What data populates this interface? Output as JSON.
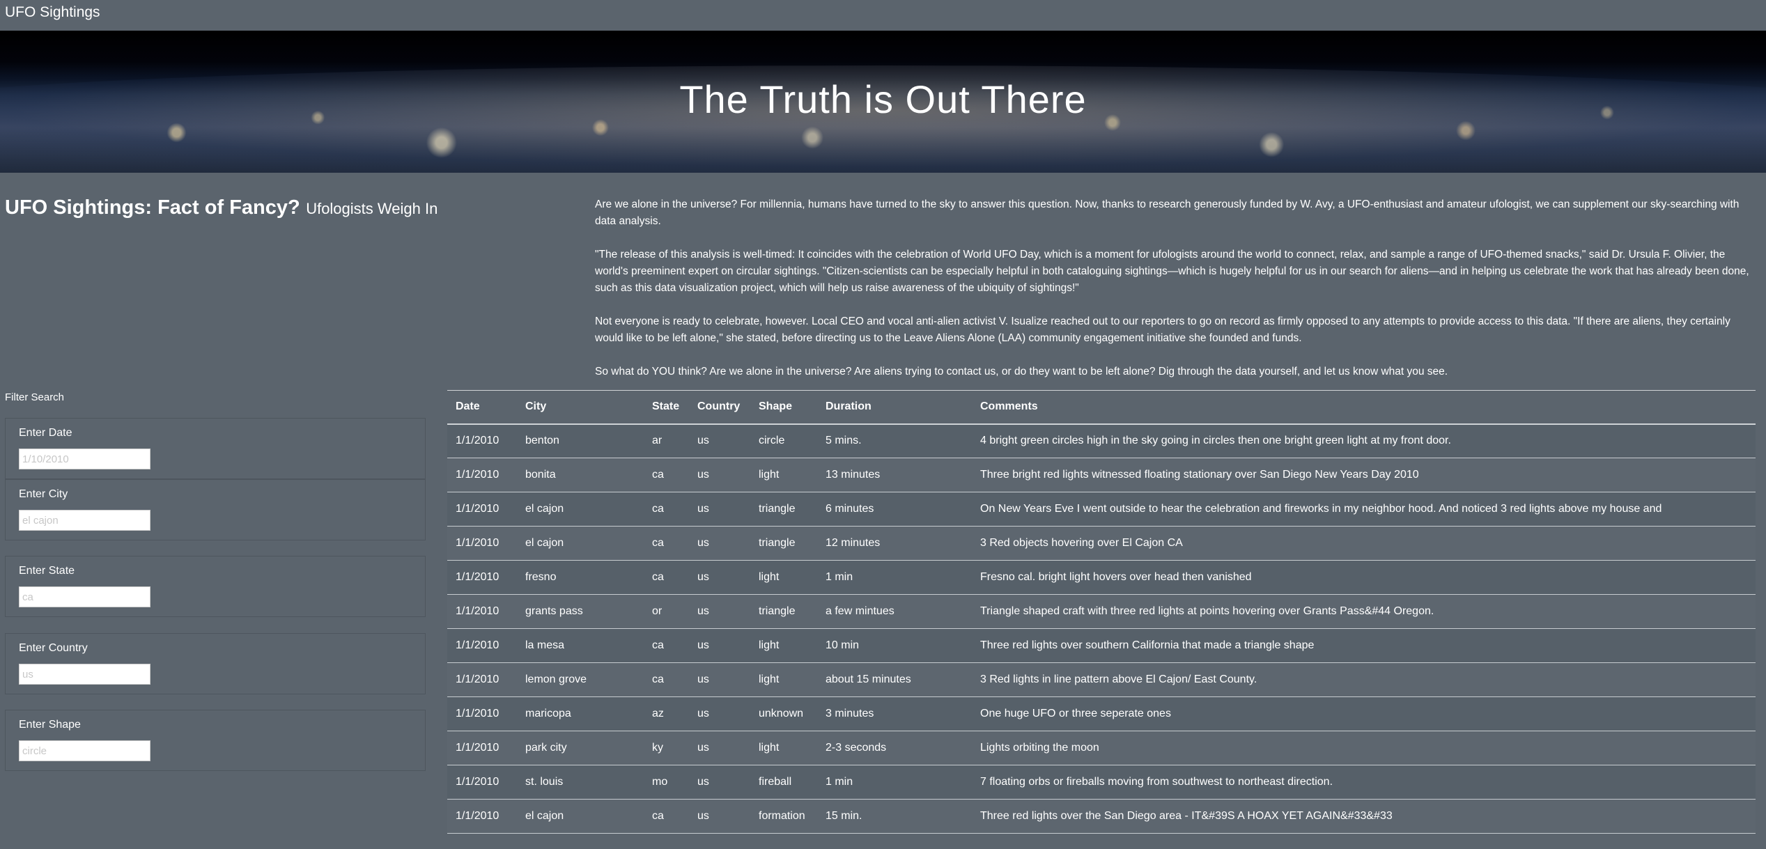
{
  "navbar": {
    "brand": "UFO Sightings"
  },
  "hero": {
    "title": "The Truth is Out There"
  },
  "headline": {
    "main": "UFO Sightings: Fact of Fancy?",
    "sub": "Ufologists Weigh In"
  },
  "article": {
    "paragraphs": [
      "Are we alone in the universe? For millennia, humans have turned to the sky to answer this question. Now, thanks to research generously funded by W. Avy, a UFO-enthusiast and amateur ufologist, we can supplement our sky-searching with data analysis.",
      "\"The release of this analysis is well-timed: It coincides with the celebration of World UFO Day, which is a moment for ufologists around the world to connect, relax, and sample a range of UFO-themed snacks,\" said Dr. Ursula F. Olivier, the world's preeminent expert on circular sightings. \"Citizen-scientists can be especially helpful in both cataloguing sightings—which is hugely helpful for us in our search for aliens—and in helping us celebrate the work that has already been done, such as this data visualization project, which will help us raise awareness of the ubiquity of sightings!\"",
      "Not everyone is ready to celebrate, however. Local CEO and vocal anti-alien activist V. Isualize reached out to our reporters to go on record as firmly opposed to any attempts to provide access to this data. \"If there are aliens, they certainly would like to be left alone,\" she stated, before directing us to the Leave Aliens Alone (LAA) community engagement initiative she founded and funds.",
      "So what do YOU think? Are we alone in the universe? Are aliens trying to contact us, or do they want to be left alone? Dig through the data yourself, and let us know what you see."
    ]
  },
  "filters": {
    "title": "Filter Search",
    "date": {
      "label": "Enter Date",
      "placeholder": "1/10/2010",
      "value": ""
    },
    "city": {
      "label": "Enter City",
      "placeholder": "el cajon",
      "value": ""
    },
    "state": {
      "label": "Enter State",
      "placeholder": "ca",
      "value": ""
    },
    "country": {
      "label": "Enter Country",
      "placeholder": "us",
      "value": ""
    },
    "shape": {
      "label": "Enter Shape",
      "placeholder": "circle",
      "value": ""
    }
  },
  "table": {
    "headers": [
      "Date",
      "City",
      "State",
      "Country",
      "Shape",
      "Duration",
      "Comments"
    ],
    "rows": [
      [
        "1/1/2010",
        "benton",
        "ar",
        "us",
        "circle",
        "5 mins.",
        "4 bright green circles high in the sky going in circles then one bright green light at my front door."
      ],
      [
        "1/1/2010",
        "bonita",
        "ca",
        "us",
        "light",
        "13 minutes",
        "Three bright red lights witnessed floating stationary over San Diego New Years Day 2010"
      ],
      [
        "1/1/2010",
        "el cajon",
        "ca",
        "us",
        "triangle",
        "6 minutes",
        "On New Years Eve I went outside to hear the celebration and fireworks in my neighbor hood. And noticed 3 red lights above my house and"
      ],
      [
        "1/1/2010",
        "el cajon",
        "ca",
        "us",
        "triangle",
        "12 minutes",
        "3 Red objects hovering over El Cajon CA"
      ],
      [
        "1/1/2010",
        "fresno",
        "ca",
        "us",
        "light",
        "1 min",
        "Fresno cal. bright light hovers over head then vanished"
      ],
      [
        "1/1/2010",
        "grants pass",
        "or",
        "us",
        "triangle",
        "a few mintues",
        "Triangle shaped craft with three red lights at points hovering over Grants Pass&#44 Oregon."
      ],
      [
        "1/1/2010",
        "la mesa",
        "ca",
        "us",
        "light",
        "10 min",
        "Three red lights over southern California that made a triangle shape"
      ],
      [
        "1/1/2010",
        "lemon grove",
        "ca",
        "us",
        "light",
        "about 15 minutes",
        "3 Red lights in line pattern above El Cajon/ East County."
      ],
      [
        "1/1/2010",
        "maricopa",
        "az",
        "us",
        "unknown",
        "3 minutes",
        "One huge UFO or three seperate ones"
      ],
      [
        "1/1/2010",
        "park city",
        "ky",
        "us",
        "light",
        "2-3 seconds",
        "Lights orbiting the moon"
      ],
      [
        "1/1/2010",
        "st. louis",
        "mo",
        "us",
        "fireball",
        "1 min",
        "7 floating orbs or fireballs moving from southwest to northeast direction."
      ],
      [
        "1/1/2010",
        "el cajon",
        "ca",
        "us",
        "formation",
        "15 min.",
        "Three red lights over the San Diego area - IT&#39S A HOAX YET AGAIN&#33&#33"
      ]
    ]
  }
}
